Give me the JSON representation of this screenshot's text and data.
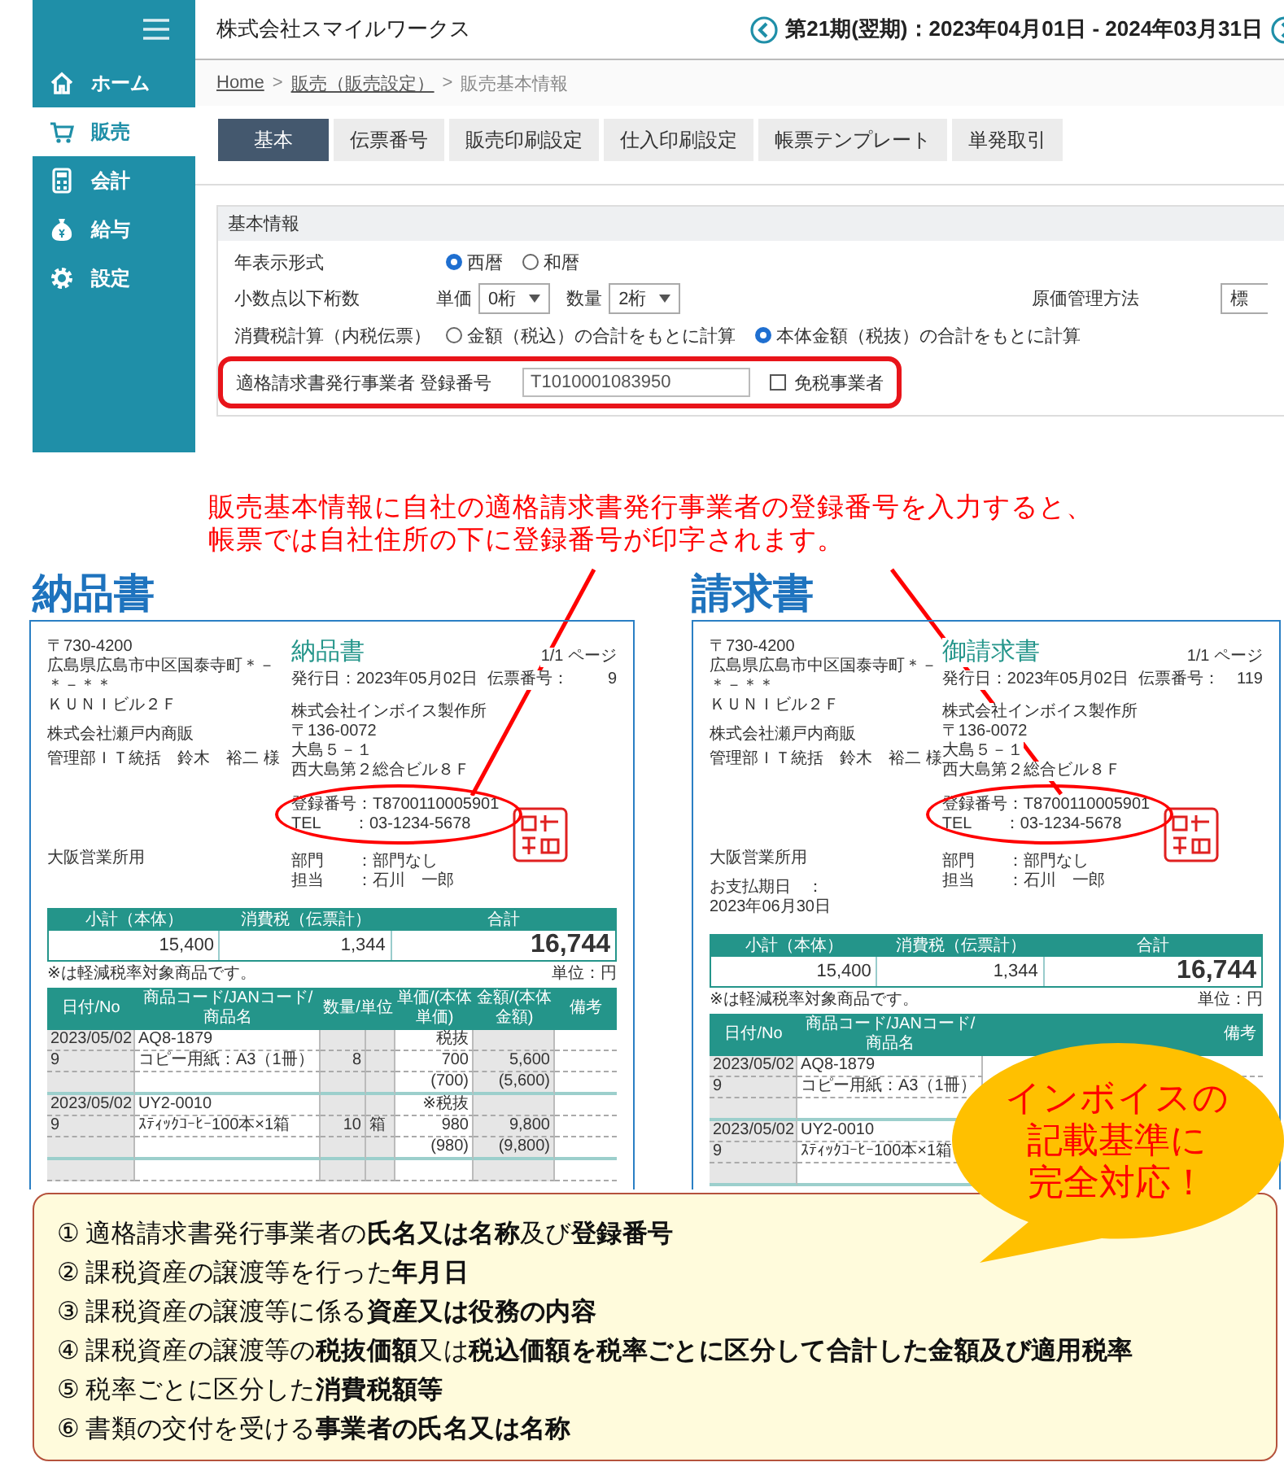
{
  "app": {
    "company": "株式会社スマイルワークス",
    "period": "第21期(翌期)：2023年04月01日 - 2024年03月31日",
    "sidebar": [
      {
        "label": "ホーム",
        "selected": false
      },
      {
        "label": "販売",
        "selected": true
      },
      {
        "label": "会計",
        "selected": false
      },
      {
        "label": "給与",
        "selected": false
      },
      {
        "label": "設定",
        "selected": false
      }
    ],
    "breadcrumb": {
      "separator": ">",
      "items": [
        {
          "label": "Home",
          "link": true
        },
        {
          "label": "販売（販売設定）",
          "link": true
        },
        {
          "label": "販売基本情報",
          "link": false
        }
      ]
    },
    "tabs": [
      {
        "label": "基本",
        "selected": true
      },
      {
        "label": "伝票番号",
        "selected": false
      },
      {
        "label": "販売印刷設定",
        "selected": false
      },
      {
        "label": "仕入印刷設定",
        "selected": false
      },
      {
        "label": "帳票テンプレート",
        "selected": false
      },
      {
        "label": "単発取引",
        "selected": false
      }
    ],
    "section": {
      "title": "基本情報",
      "rows": [
        {
          "kind": "radio",
          "label": "年表示形式",
          "options": [
            {
              "label": "西暦",
              "selected": true
            },
            {
              "label": "和暦",
              "selected": false
            }
          ]
        },
        {
          "kind": "selects",
          "label": "小数点以下桁数",
          "fields": [
            {
              "label": "単価",
              "value": "0桁"
            },
            {
              "label": "数量",
              "value": "2桁"
            }
          ],
          "side": {
            "label": "原価管理方法",
            "value": "標"
          }
        },
        {
          "kind": "radio",
          "label": "消費税計算（内税伝票）",
          "options": [
            {
              "label": "金額（税込）の合計をもとに計算",
              "selected": false
            },
            {
              "label": "本体金額（税抜）の合計をもとに計算",
              "selected": true
            }
          ]
        },
        {
          "kind": "registration",
          "label": "適格請求書発行事業者 登録番号",
          "value": "T1010001083950",
          "highlighted": true,
          "checkbox": {
            "label": "免税事業者",
            "checked": false
          }
        }
      ]
    }
  },
  "callout": {
    "lines": [
      "販売基本情報に自社の適格請求書発行事業者の登録番号を入力すると、",
      "帳票では自社住所の下に登録番号が印字されます。"
    ]
  },
  "documents": [
    {
      "heading": "納品書",
      "title": "納品書",
      "page": "1/1 ページ",
      "issue_date": "発行日：2023年05月02日",
      "slip_label": "伝票番号：",
      "slip_number": "9",
      "customer": [
        "〒730-4200",
        "広島県広島市中区国泰寺町＊－＊－＊＊",
        "ＫＵＮＩビル２Ｆ",
        "株式会社瀬戸内商販",
        "管理部ＩＴ統括　鈴木　裕二 様"
      ],
      "office": "大阪営業所用",
      "issuer": [
        "株式会社インボイス製作所",
        "〒136-0072",
        "大島５－１",
        "西大島第２総合ビル８Ｆ"
      ],
      "registration": [
        "登録番号：T8700110005901",
        "TEL　　：03-1234-5678"
      ],
      "staff": [
        "部門　　：部門なし",
        "担当　　：石川　一郎"
      ],
      "totals": {
        "headers": [
          "小計（本体）",
          "消費税（伝票計）",
          "合計"
        ],
        "values": [
          "15,400",
          "1,344",
          "16,744"
        ]
      },
      "note": "※は軽減税率対象商品です。",
      "unit": "単位：円",
      "columns": {
        "date": "日付/No",
        "product": "商品コード/JANコード/商品名",
        "qty": "数量/単位",
        "price": "単価/(本体単価)",
        "amount": "金額/(本体金額)",
        "note": "備考"
      },
      "items": [
        {
          "lines": [
            {
              "date": "2023/05/02",
              "product": "AQ8-1879",
              "price": "税抜"
            },
            {
              "date": "9",
              "product": "コピー用紙：A3（1冊）",
              "qty": "8",
              "price": "700",
              "amount": "5,600"
            },
            {
              "price": "(700)",
              "amount": "(5,600)"
            }
          ]
        },
        {
          "lines": [
            {
              "date": "2023/05/02",
              "product": "UY2-0010",
              "price": "※税抜"
            },
            {
              "date": "9",
              "product": "ｽﾃｨｯｸｺｰﾋｰ100本×1箱",
              "qty": "10",
              "unit": "箱",
              "price": "980",
              "amount": "9,800"
            },
            {
              "price": "(980)",
              "amount": "(9,800)"
            }
          ]
        }
      ]
    },
    {
      "heading": "請求書",
      "title": "御請求書",
      "page": "1/1 ページ",
      "issue_date": "発行日：2023年05月02日",
      "slip_label": "伝票番号：",
      "slip_number": "119",
      "customer": [
        "〒730-4200",
        "広島県広島市中区国泰寺町＊－＊－＊＊",
        "ＫＵＮＩビル２Ｆ",
        "株式会社瀬戸内商販",
        "管理部ＩＴ統括　鈴木　裕二 様"
      ],
      "office": "大阪営業所用",
      "due": "お支払期日　：　2023年06月30日",
      "issuer": [
        "株式会社インボイス製作所",
        "〒136-0072",
        "大島５－１",
        "西大島第２総合ビル８Ｆ"
      ],
      "registration": [
        "登録番号：T8700110005901",
        "TEL　　：03-1234-5678"
      ],
      "staff": [
        "部門　　：部門なし",
        "担当　　：石川　一郎"
      ],
      "totals": {
        "headers": [
          "小計（本体）",
          "消費税（伝票計）",
          "合計"
        ],
        "values": [
          "15,400",
          "1,344",
          "16,744"
        ]
      },
      "note": "※は軽減税率対象商品です。",
      "unit": "単位：円",
      "columns": {
        "date": "日付/No",
        "product": "商品コード/JANコード/商品名",
        "note": "備考"
      },
      "items": [
        {
          "lines": [
            {
              "date": "2023/05/02",
              "product": "AQ8-1879"
            },
            {
              "date": "9",
              "product": "コピー用紙：A3（1冊）"
            }
          ]
        },
        {
          "lines": [
            {
              "date": "2023/05/02",
              "product": "UY2-0010"
            },
            {
              "date": "9",
              "product": "ｽﾃｨｯｸｺｰﾋｰ100本×1箱"
            }
          ]
        }
      ]
    }
  ],
  "bubble": {
    "lines": [
      "インボイスの",
      "記載基準に",
      "完全対応！"
    ]
  },
  "requirements": [
    "① 適格請求書発行事業者の**氏名又は名称**及び**登録番号**",
    "② 課税資産の譲渡等を行った**年月日**",
    "③ 課税資産の譲渡等に係る**資産又は役務の内容**",
    "④ 課税資産の譲渡等の**税抜価額**又は**税込価額を税率ごとに区分して合計した金額及び適用税率**",
    "⑤ 税率ごとに区分した**消費税額等**",
    "⑥ 書類の交付を受ける**事業者の氏名又は名称**"
  ]
}
